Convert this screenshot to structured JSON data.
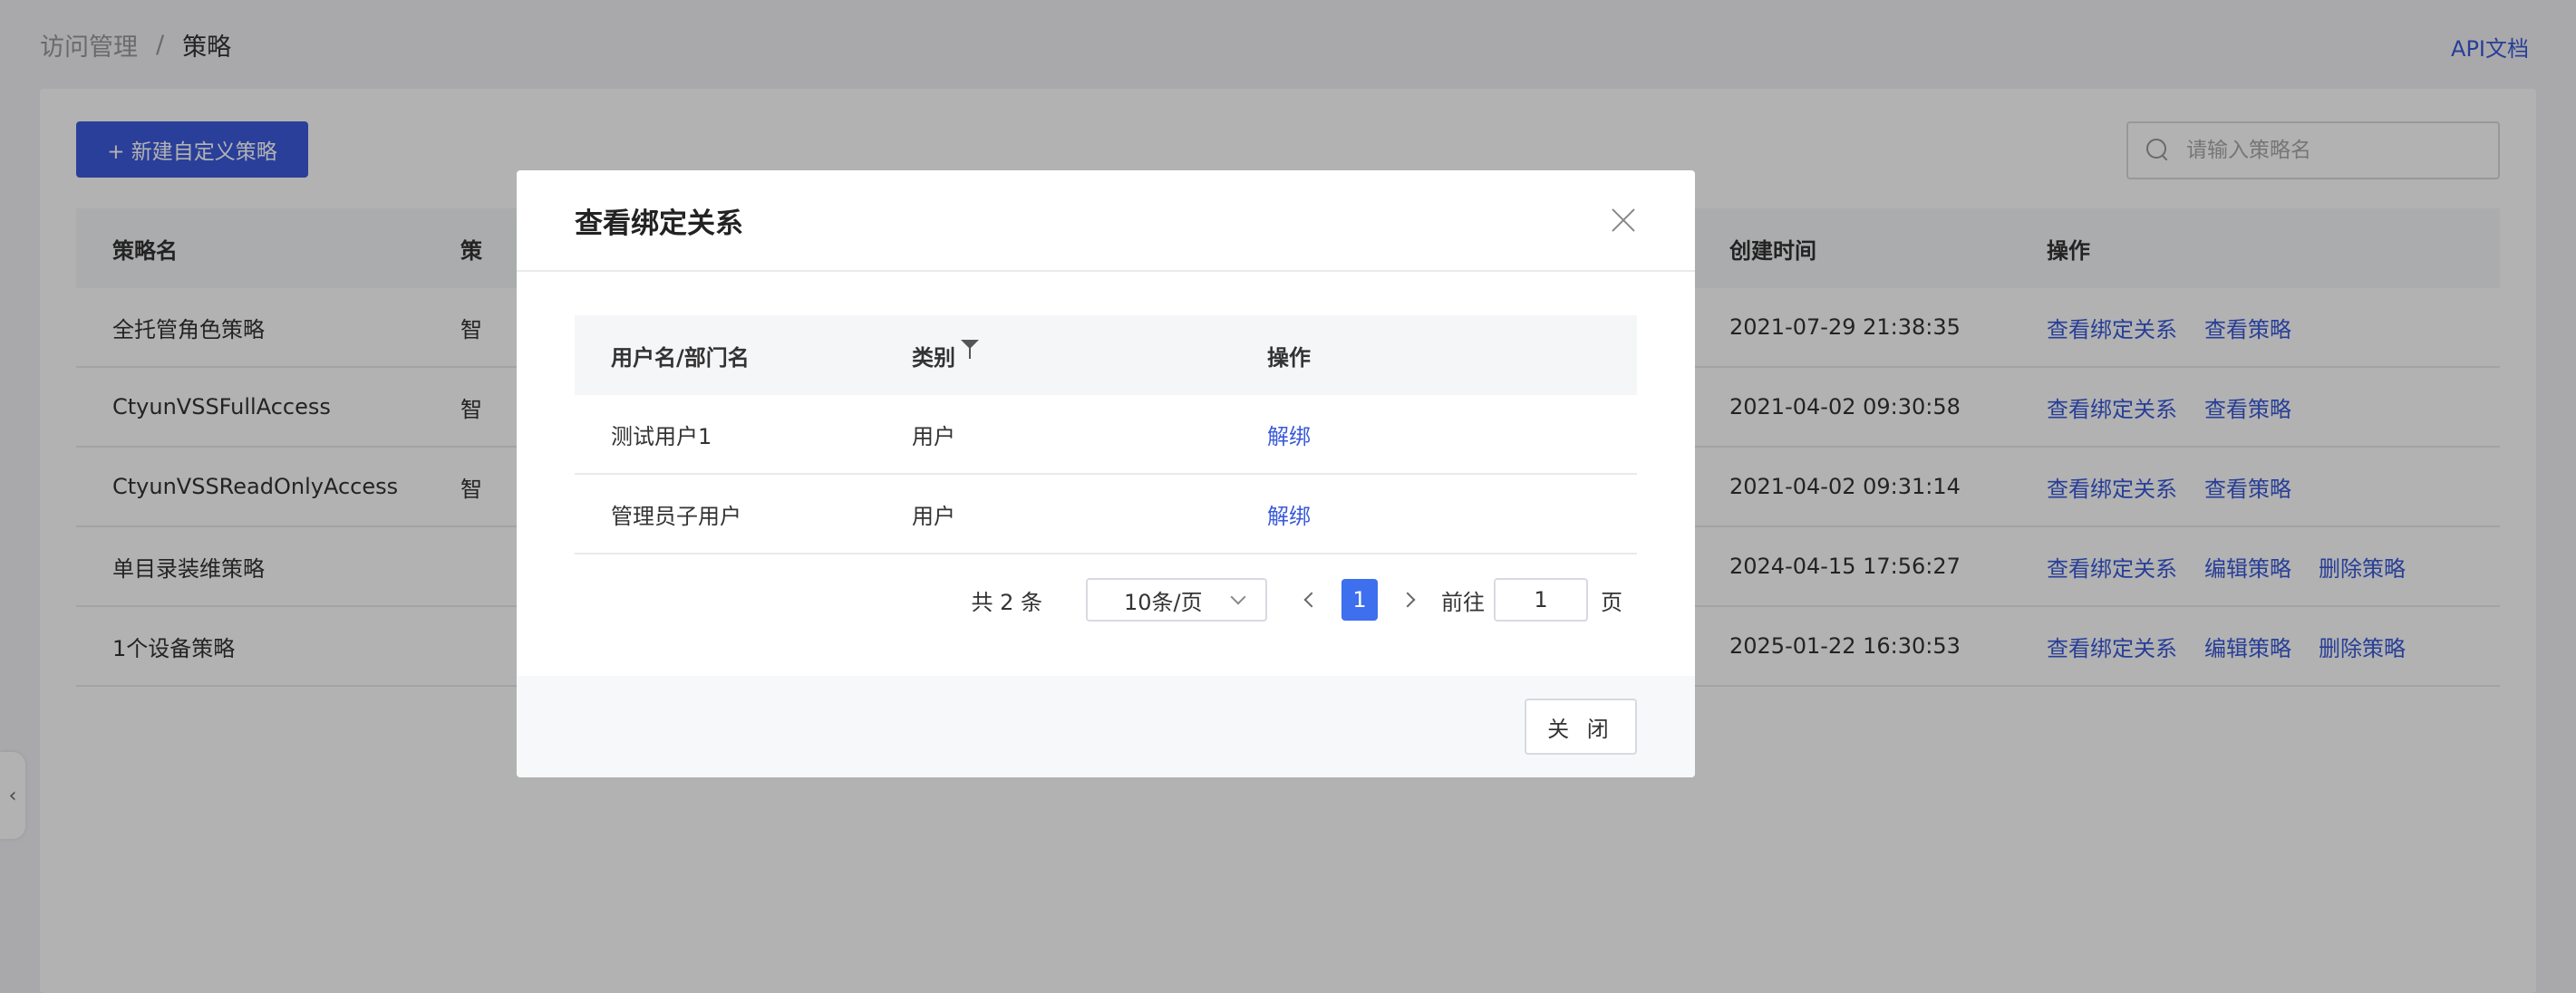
{
  "header": {
    "breadcrumb_root": "访问管理",
    "breadcrumb_sep": "/",
    "breadcrumb_current": "策略",
    "api_link": "API文档"
  },
  "toolbar": {
    "new_button": "+ 新建自定义策略",
    "search_placeholder": "请输入策略名"
  },
  "table": {
    "columns": [
      "策略名",
      "策",
      "创建时间",
      "操作"
    ],
    "rows": [
      {
        "name": "全托管角色策略",
        "type": "智",
        "created": "2021-07-29 21:38:35",
        "actions": [
          "查看绑定关系",
          "查看策略"
        ]
      },
      {
        "name": "CtyunVSSFullAccess",
        "type": "智",
        "created": "2021-04-02 09:30:58",
        "actions": [
          "查看绑定关系",
          "查看策略"
        ]
      },
      {
        "name": "CtyunVSSReadOnlyAccess",
        "type": "智",
        "created": "2021-04-02 09:31:14",
        "actions": [
          "查看绑定关系",
          "查看策略"
        ]
      },
      {
        "name": "单目录装维策略",
        "type": "",
        "created": "2024-04-15 17:56:27",
        "actions": [
          "查看绑定关系",
          "编辑策略",
          "删除策略"
        ]
      },
      {
        "name": "1个设备策略",
        "type": "",
        "created": "2025-01-22 16:30:53",
        "actions": [
          "查看绑定关系",
          "编辑策略",
          "删除策略"
        ]
      }
    ]
  },
  "modal": {
    "title": "查看绑定关系",
    "columns": [
      "用户名/部门名",
      "类别",
      "操作"
    ],
    "rows": [
      {
        "name": "测试用户1",
        "category": "用户",
        "action": "解绑"
      },
      {
        "name": "管理员子用户",
        "category": "用户",
        "action": "解绑"
      }
    ],
    "pager": {
      "total": "共 2 条",
      "page_size": "10条/页",
      "current_page": "1",
      "goto_label": "前往",
      "goto_value": "1",
      "page_suffix": "页"
    },
    "close_button": "关 闭"
  }
}
